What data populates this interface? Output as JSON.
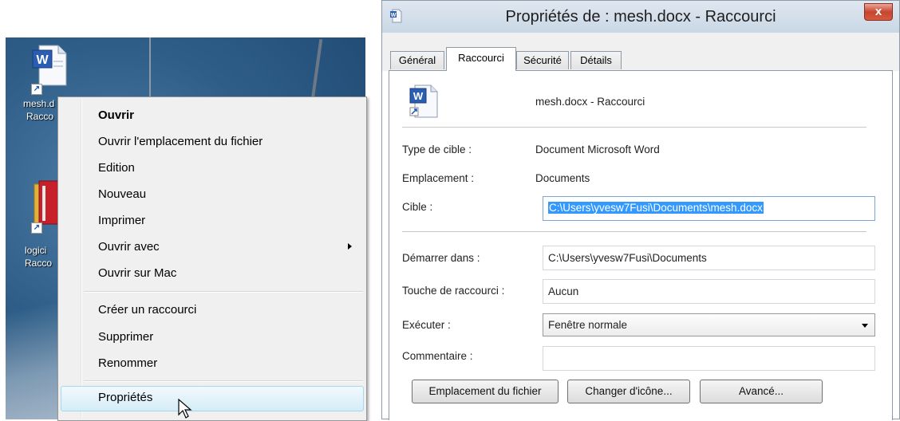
{
  "desktop": {
    "icon1_label_line1": "mesh.d",
    "icon1_label_line2": "Racco",
    "icon2_label_line1": "logici",
    "icon2_label_line2": "Racco"
  },
  "context_menu": {
    "items": [
      {
        "label": "Ouvrir"
      },
      {
        "label": "Ouvrir l'emplacement du fichier"
      },
      {
        "label": "Edition"
      },
      {
        "label": "Nouveau"
      },
      {
        "label": "Imprimer"
      },
      {
        "label": "Ouvrir avec"
      },
      {
        "label": "Ouvrir sur Mac"
      },
      {
        "label": "Créer un raccourci"
      },
      {
        "label": "Supprimer"
      },
      {
        "label": "Renommer"
      },
      {
        "label": "Propriétés"
      }
    ]
  },
  "dialog": {
    "title": "Propriétés de : mesh.docx - Raccourci",
    "close_glyph": "x",
    "tabs": [
      {
        "label": "Général"
      },
      {
        "label": "Raccourci"
      },
      {
        "label": "Sécurité"
      },
      {
        "label": "Détails"
      }
    ],
    "shortcut_name": "mesh.docx - Raccourci",
    "target_type_label": "Type de cible :",
    "target_type_value": "Document Microsoft Word",
    "location_label": "Emplacement :",
    "location_value": "Documents",
    "target_label": "Cible :",
    "target_value": "C:\\Users\\yvesw7Fusi\\Documents\\mesh.docx",
    "start_in_label": "Démarrer dans :",
    "start_in_value": "C:\\Users\\yvesw7Fusi\\Documents",
    "hotkey_label": "Touche de raccourci :",
    "hotkey_value": "Aucun",
    "run_label": "Exécuter :",
    "run_value": "Fenêtre normale",
    "comment_label": "Commentaire :",
    "comment_value": "",
    "buttons": {
      "open_location": "Emplacement du fichier",
      "change_icon": "Changer d'icône...",
      "advanced": "Avancé..."
    }
  },
  "colors": {
    "selection": "#3399ff",
    "menu_bg": "#f0f0f0",
    "close_red": "#c7452f"
  }
}
